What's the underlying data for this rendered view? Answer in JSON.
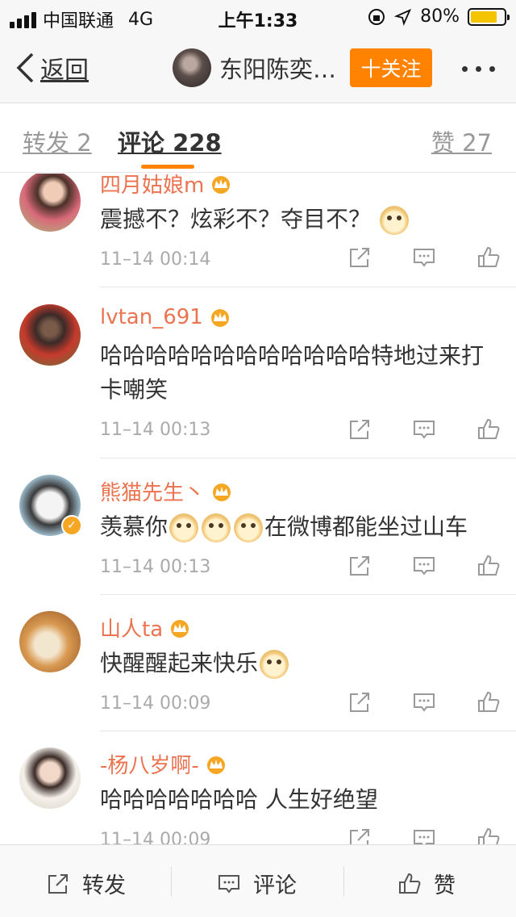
{
  "status_bar": {
    "carrier": "中国联通",
    "network": "4G",
    "time": "上午1:33",
    "battery": "80%",
    "battery_level": 0.8
  },
  "nav": {
    "back_label": "返回",
    "title": "东阳陈奕…",
    "follow_label": "十关注"
  },
  "tabs": {
    "repost": "转发 2",
    "comment": "评论 228",
    "like": "赞 27"
  },
  "comments": [
    {
      "username": "四月姑娘m",
      "text": "震撼不？炫彩不？夺目不？",
      "time": "11–14 00:14"
    },
    {
      "username": "lvtan_691",
      "text": "哈哈哈哈哈哈哈哈哈哈哈哈特地过来打卡嘲笑",
      "time": "11–14 00:13"
    },
    {
      "username": "熊猫先生丶",
      "text_before": "羡慕你",
      "text_after": "在微博都能坐过山车",
      "time": "11–14 00:13"
    },
    {
      "username": "山人ta",
      "text": "快醒醒起来快乐",
      "time": "11–14 00:09"
    },
    {
      "username": "-杨八岁啊-",
      "text": "哈哈哈哈哈哈哈 人生好绝望",
      "time": "11–14 00:09"
    }
  ],
  "bottom_bar": {
    "repost": "转发",
    "comment": "评论",
    "like": "赞"
  },
  "colors": {
    "accent": "#ff8200",
    "username": "#eb7350",
    "vip_crown": "#f5a623"
  },
  "icons": [
    "signal-icon",
    "location-icon",
    "battery-icon",
    "back-icon",
    "share-icon",
    "comment-icon",
    "like-icon",
    "crown-icon",
    "emoji-doge-icon"
  ]
}
